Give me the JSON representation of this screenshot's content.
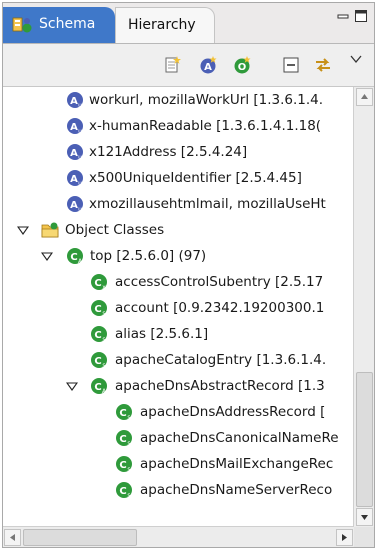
{
  "tabs": {
    "active_label": "Schema",
    "inactive_label": "Hierarchy"
  },
  "icons": {
    "attribute": "attribute-type-icon",
    "object_class": "object-class-icon",
    "folder": "folder-icon"
  },
  "colors": {
    "tab_active_bg": "#3f78c9",
    "attribute_icon": "#4b5fb5",
    "object_class_icon": "#2f9a3b"
  },
  "tree": {
    "attributes": [
      {
        "text": "workurl, mozillaWorkUrl  [1.3.6.1.4."
      },
      {
        "text": "x-humanReadable  [1.3.6.1.4.1.18("
      },
      {
        "text": "x121Address  [2.5.4.24]"
      },
      {
        "text": "x500UniqueIdentifier  [2.5.4.45]"
      },
      {
        "text": "xmozillausehtmlmail, mozillaUseHt"
      }
    ],
    "object_classes_label": "Object Classes",
    "top_label": "top  [2.5.6.0]  (97)",
    "children": [
      {
        "text": "accessControlSubentry  [2.5.17"
      },
      {
        "text": "account  [0.9.2342.19200300.1"
      },
      {
        "text": "alias  [2.5.6.1]"
      },
      {
        "text": "apacheCatalogEntry  [1.3.6.1.4."
      },
      {
        "text": "apacheDnsAbstractRecord  [1.3"
      }
    ],
    "grandchildren": [
      {
        "text": "apacheDnsAddressRecord  ["
      },
      {
        "text": "apacheDnsCanonicalNameRe"
      },
      {
        "text": "apacheDnsMailExchangeRec"
      },
      {
        "text": "apacheDnsNameServerReco"
      }
    ]
  }
}
